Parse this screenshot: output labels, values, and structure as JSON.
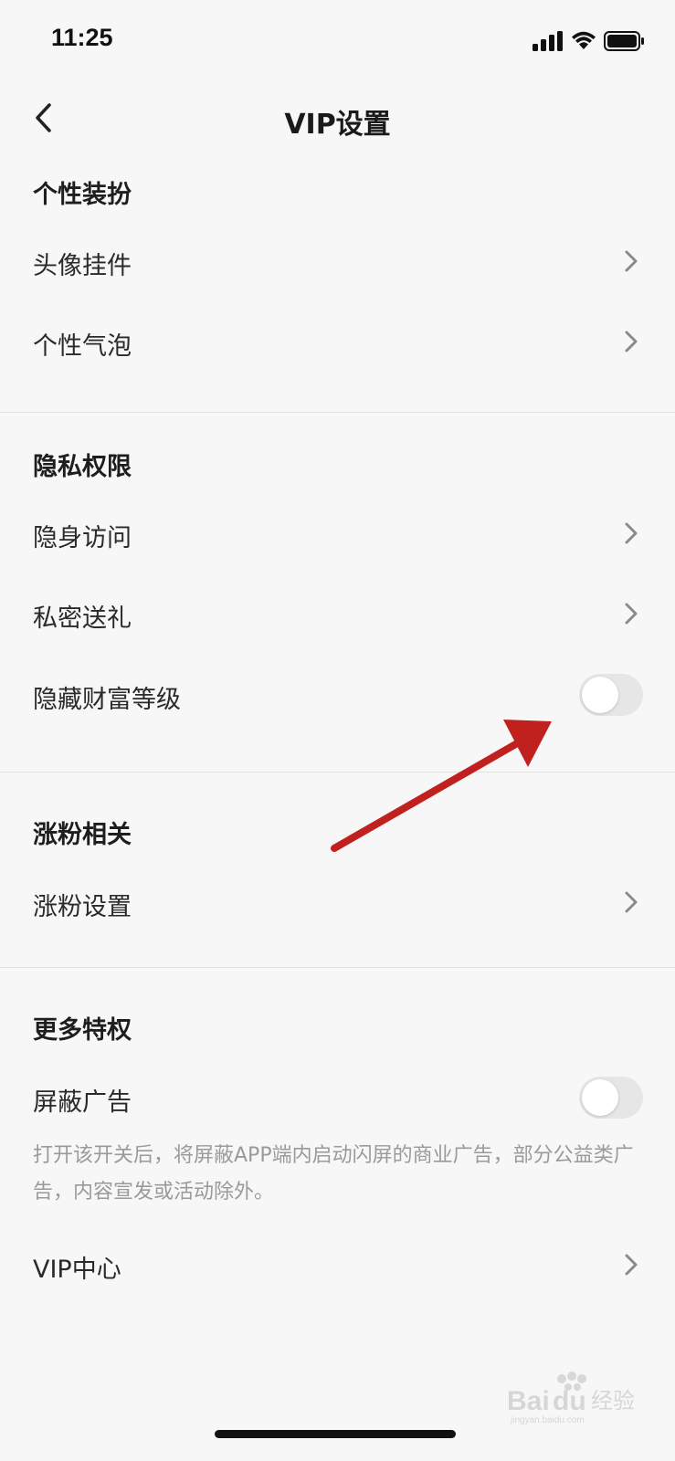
{
  "status_bar": {
    "time": "11:25"
  },
  "nav": {
    "title": "VIP设置"
  },
  "sections": {
    "personal": {
      "title": "个性装扮",
      "items": [
        {
          "label": "头像挂件"
        },
        {
          "label": "个性气泡"
        }
      ]
    },
    "privacy": {
      "title": "隐私权限",
      "items": [
        {
          "label": "隐身访问"
        },
        {
          "label": "私密送礼"
        },
        {
          "label": "隐藏财富等级",
          "toggle": "off"
        }
      ]
    },
    "fans": {
      "title": "涨粉相关",
      "items": [
        {
          "label": "涨粉设置"
        }
      ]
    },
    "more": {
      "title": "更多特权",
      "items": [
        {
          "label": "屏蔽广告",
          "toggle": "off"
        },
        {
          "label": "VIP中心"
        }
      ],
      "description": "打开该开关后，将屏蔽APP端内启动闪屏的商业广告，部分公益类广告，内容宣发或活动除外。"
    }
  },
  "watermark": {
    "text": "Baidu经验",
    "subtext": "jingyan.baidu.com"
  },
  "colors": {
    "background": "#f7f7f7",
    "annotation_arrow": "#c0201e",
    "toggle_off": "#e6e6e6"
  },
  "icons": [
    "signal-icon",
    "wifi-icon",
    "battery-icon",
    "back-arrow-icon",
    "chevron-right-icon"
  ]
}
